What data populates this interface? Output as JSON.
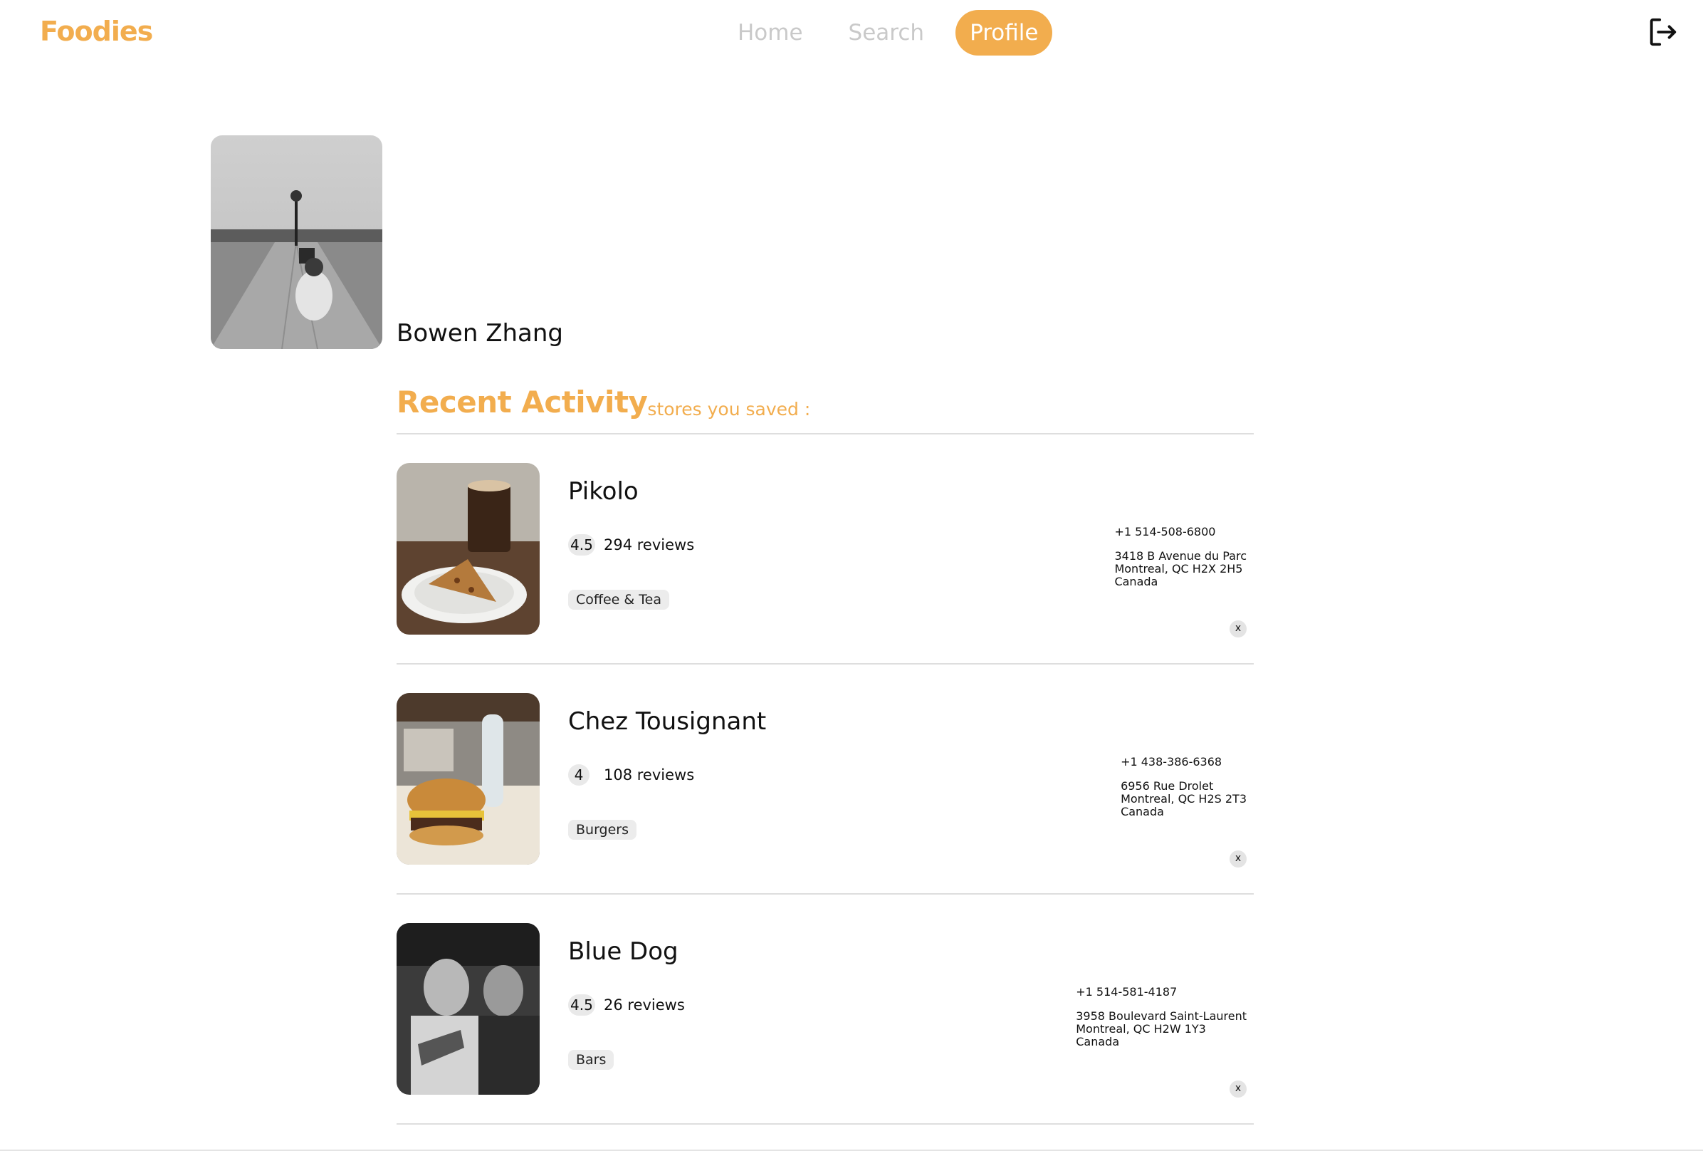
{
  "app": {
    "logo": "Foodies",
    "brand_color": "#F2AD4E"
  },
  "nav": {
    "items": [
      {
        "label": "Home",
        "active": false
      },
      {
        "label": "Search",
        "active": false
      },
      {
        "label": "Profile",
        "active": true
      }
    ],
    "logout_icon": "logout-icon"
  },
  "profile": {
    "name": "Bowen Zhang",
    "avatar_icon": "avatar-photo"
  },
  "activity": {
    "title": "Recent Activity",
    "subtitle": "stores you saved :",
    "stores": [
      {
        "name": "Pikolo",
        "rating": "4.5",
        "reviews": "294 reviews",
        "category": "Coffee & Tea",
        "phone": "+1 514-508-6800",
        "address": [
          "3418 B Avenue du Parc",
          "Montreal, QC H2X 2H5",
          "Canada"
        ],
        "remove_label": "x"
      },
      {
        "name": "Chez Tousignant",
        "rating": "4",
        "reviews": "108 reviews",
        "category": "Burgers",
        "phone": "+1 438-386-6368",
        "address": [
          "6956 Rue Drolet",
          "Montreal, QC H2S 2T3",
          "Canada"
        ],
        "remove_label": "x"
      },
      {
        "name": "Blue Dog",
        "rating": "4.5",
        "reviews": "26 reviews",
        "category": "Bars",
        "phone": "+1 514-581-4187",
        "address": [
          "3958 Boulevard Saint-Laurent",
          "Montreal, QC H2W 1Y3",
          "Canada"
        ],
        "remove_label": "x"
      }
    ]
  }
}
